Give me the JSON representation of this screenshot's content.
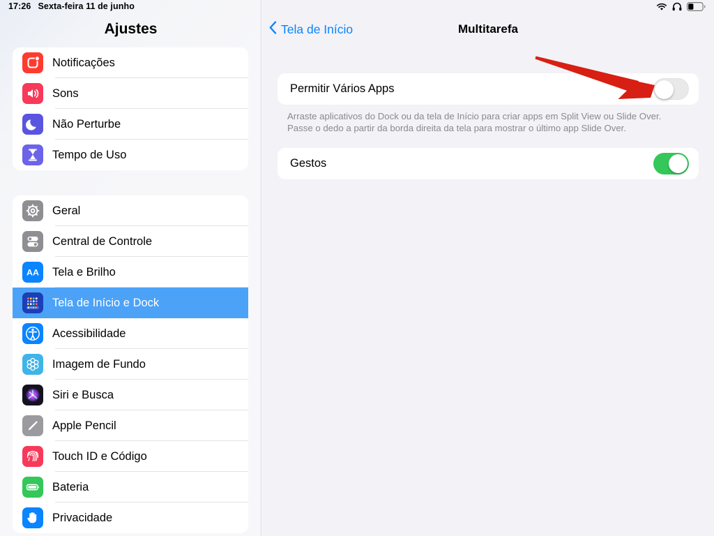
{
  "statusbar": {
    "time": "17:26",
    "date": "Sexta-feira 11 de junho",
    "icons": [
      "wifi-icon",
      "headphones-icon",
      "battery-icon"
    ]
  },
  "sidebar": {
    "title": "Ajustes",
    "groups": [
      {
        "items": [
          {
            "label": "Notificações",
            "icon": "notifications-icon",
            "selected": false
          },
          {
            "label": "Sons",
            "icon": "sounds-icon",
            "selected": false
          },
          {
            "label": "Não Perturbe",
            "icon": "moon-icon",
            "selected": false
          },
          {
            "label": "Tempo de Uso",
            "icon": "hourglass-icon",
            "selected": false
          }
        ]
      },
      {
        "items": [
          {
            "label": "Geral",
            "icon": "gear-icon",
            "selected": false
          },
          {
            "label": "Central de Controle",
            "icon": "control-center-icon",
            "selected": false
          },
          {
            "label": "Tela e Brilho",
            "icon": "display-aa-icon",
            "selected": false
          },
          {
            "label": "Tela de Início e Dock",
            "icon": "home-screen-icon",
            "selected": true
          },
          {
            "label": "Acessibilidade",
            "icon": "accessibility-icon",
            "selected": false
          },
          {
            "label": "Imagem de Fundo",
            "icon": "wallpaper-icon",
            "selected": false
          },
          {
            "label": "Siri e Busca",
            "icon": "siri-icon",
            "selected": false
          },
          {
            "label": "Apple Pencil",
            "icon": "pencil-icon",
            "selected": false
          },
          {
            "label": "Touch ID e Código",
            "icon": "fingerprint-icon",
            "selected": false
          },
          {
            "label": "Bateria",
            "icon": "battery-green-icon",
            "selected": false
          },
          {
            "label": "Privacidade",
            "icon": "privacy-hand-icon",
            "selected": false
          }
        ]
      }
    ]
  },
  "detail": {
    "back_label": "Tela de Início",
    "back_icon": "chevron-left-icon",
    "title": "Multitarefa",
    "rows": [
      {
        "label": "Permitir Vários Apps",
        "toggle": "off"
      },
      {
        "label": "Gestos",
        "toggle": "on"
      }
    ],
    "footnote_line1": "Arraste aplicativos do Dock ou da tela de Início para criar apps em Split View ou Slide Over.",
    "footnote_line2": "Passe o dedo a partir da borda direita da tela para mostrar o último app Slide Over."
  },
  "annotation": {
    "type": "arrow",
    "color": "#d81f13",
    "points_to": "permitir-varios-apps-toggle"
  },
  "colors": {
    "accent_blue": "#0a84ff",
    "selection_blue": "#4ca2f7",
    "toggle_on_green": "#34c759",
    "toggle_off_gray": "#e9e9ea",
    "pane_background": "#f2f2f7",
    "annotation_red": "#d81f13"
  }
}
